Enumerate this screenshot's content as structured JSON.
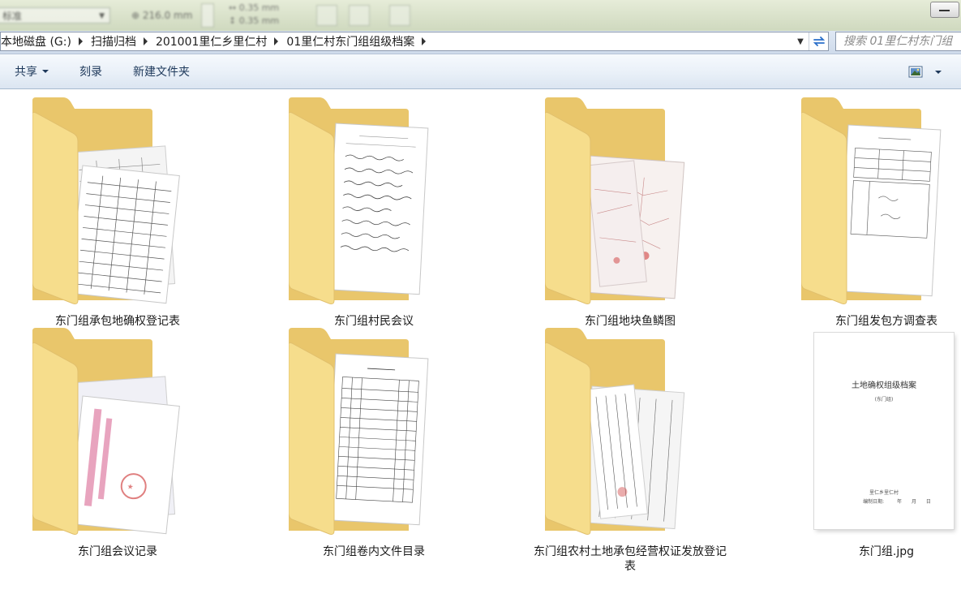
{
  "ribbon": {
    "style_combo": "标准",
    "font_size_value": "216.0 mm",
    "offset_1": "0.35 mm",
    "offset_2": "0.35 mm"
  },
  "address": {
    "crumbs": [
      "本地磁盘 (G:)",
      "扫描归档",
      "201001里仁乡里仁村",
      "01里仁村东门组组级档案"
    ],
    "search_placeholder": "搜索 01里仁村东门组"
  },
  "toolbar": {
    "share_label": "共享",
    "burn_label": "刻录",
    "new_folder_label": "新建文件夹"
  },
  "files": [
    {
      "name": "东门组承包地确权登记表",
      "type": "folder",
      "preview": "table",
      "icon": "folder-icon"
    },
    {
      "name": "东门组村民会议",
      "type": "folder",
      "preview": "handwriting",
      "icon": "folder-icon"
    },
    {
      "name": "东门组地块鱼鳞图",
      "type": "folder",
      "preview": "map",
      "icon": "folder-icon"
    },
    {
      "name": "东门组发包方调查表",
      "type": "folder",
      "preview": "survey",
      "icon": "folder-icon"
    },
    {
      "name": "东门组会议记录",
      "type": "folder",
      "preview": "stamp",
      "icon": "folder-icon"
    },
    {
      "name": "东门组卷内文件目录",
      "type": "folder",
      "preview": "catalog",
      "icon": "folder-icon"
    },
    {
      "name": "东门组农村土地承包经营权证发放登记表",
      "type": "folder",
      "preview": "register",
      "icon": "folder-icon"
    },
    {
      "name": "东门组.jpg",
      "type": "image",
      "preview": "cover",
      "icon": "image-thumbnail"
    }
  ],
  "cover_doc": {
    "title": "土地确权组级档案",
    "subtitle": "(东门组)",
    "footer_1": "里仁乡里仁村",
    "footer_2": "编制日期:",
    "footer_3": "年",
    "footer_4": "月",
    "footer_5": "日"
  },
  "colors": {
    "folder_back": "#e9c66b",
    "folder_front": "#f6dd8c",
    "cmdbar_text": "#1e395b",
    "address_border": "#8b99ad"
  }
}
